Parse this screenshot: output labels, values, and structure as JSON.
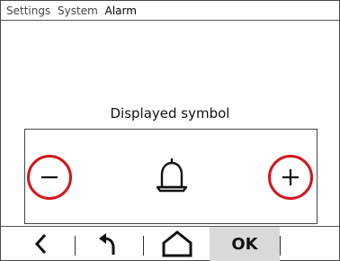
{
  "breadcrumb": [
    "Settings",
    "System",
    "Alarm"
  ],
  "content": {
    "label": "Displayed symbol",
    "minus_icon": "minus-icon",
    "plus_icon": "plus-icon",
    "symbol_icon": "bell-icon"
  },
  "footer": {
    "back_icon": "chevron-left-icon",
    "return_icon": "undo-arrow-icon",
    "home_icon": "home-icon",
    "ok_label": "OK"
  },
  "colors": {
    "highlight_ring": "#d3171e",
    "ok_background": "#d9d9d9"
  }
}
